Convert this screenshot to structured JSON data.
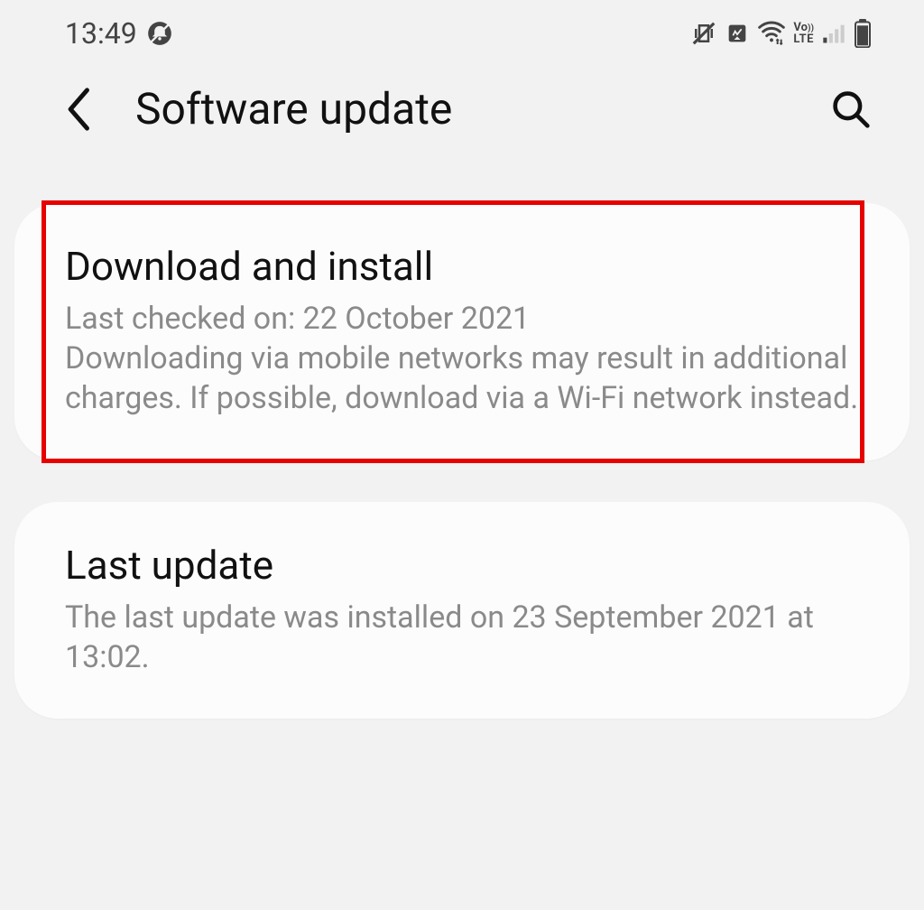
{
  "status_bar": {
    "time": "13:49"
  },
  "app_bar": {
    "title": "Software update"
  },
  "cards": {
    "download_install": {
      "title": "Download and install",
      "last_checked": "Last checked on: 22 October 2021",
      "warning": "Downloading via mobile networks may result in additional charges. If possible, download via a Wi-Fi network instead."
    },
    "last_update": {
      "title": "Last update",
      "info": "The last update was installed on 23 September 2021 at 13:02."
    }
  }
}
